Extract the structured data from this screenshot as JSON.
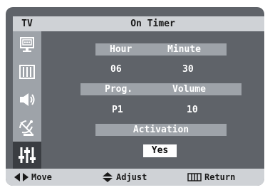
{
  "menu": {
    "badge": "TV",
    "title": "On Timer"
  },
  "sidebar": {
    "items": [
      {
        "icon": "picture-icon"
      },
      {
        "icon": "sound-icon"
      },
      {
        "icon": "speaker-icon"
      },
      {
        "icon": "antenna-icon"
      },
      {
        "icon": "setup-icon",
        "active": true
      }
    ]
  },
  "timer": {
    "hour_label": "Hour",
    "minute_label": "Minute",
    "hour_value": "06",
    "minute_value": "30",
    "prog_label": "Prog.",
    "volume_label": "Volume",
    "prog_value": "P1",
    "volume_value": "10",
    "activation_label": "Activation",
    "activation_value": "Yes"
  },
  "footer": {
    "move_label": "Move",
    "adjust_label": "Adjust",
    "return_label": "Return"
  }
}
